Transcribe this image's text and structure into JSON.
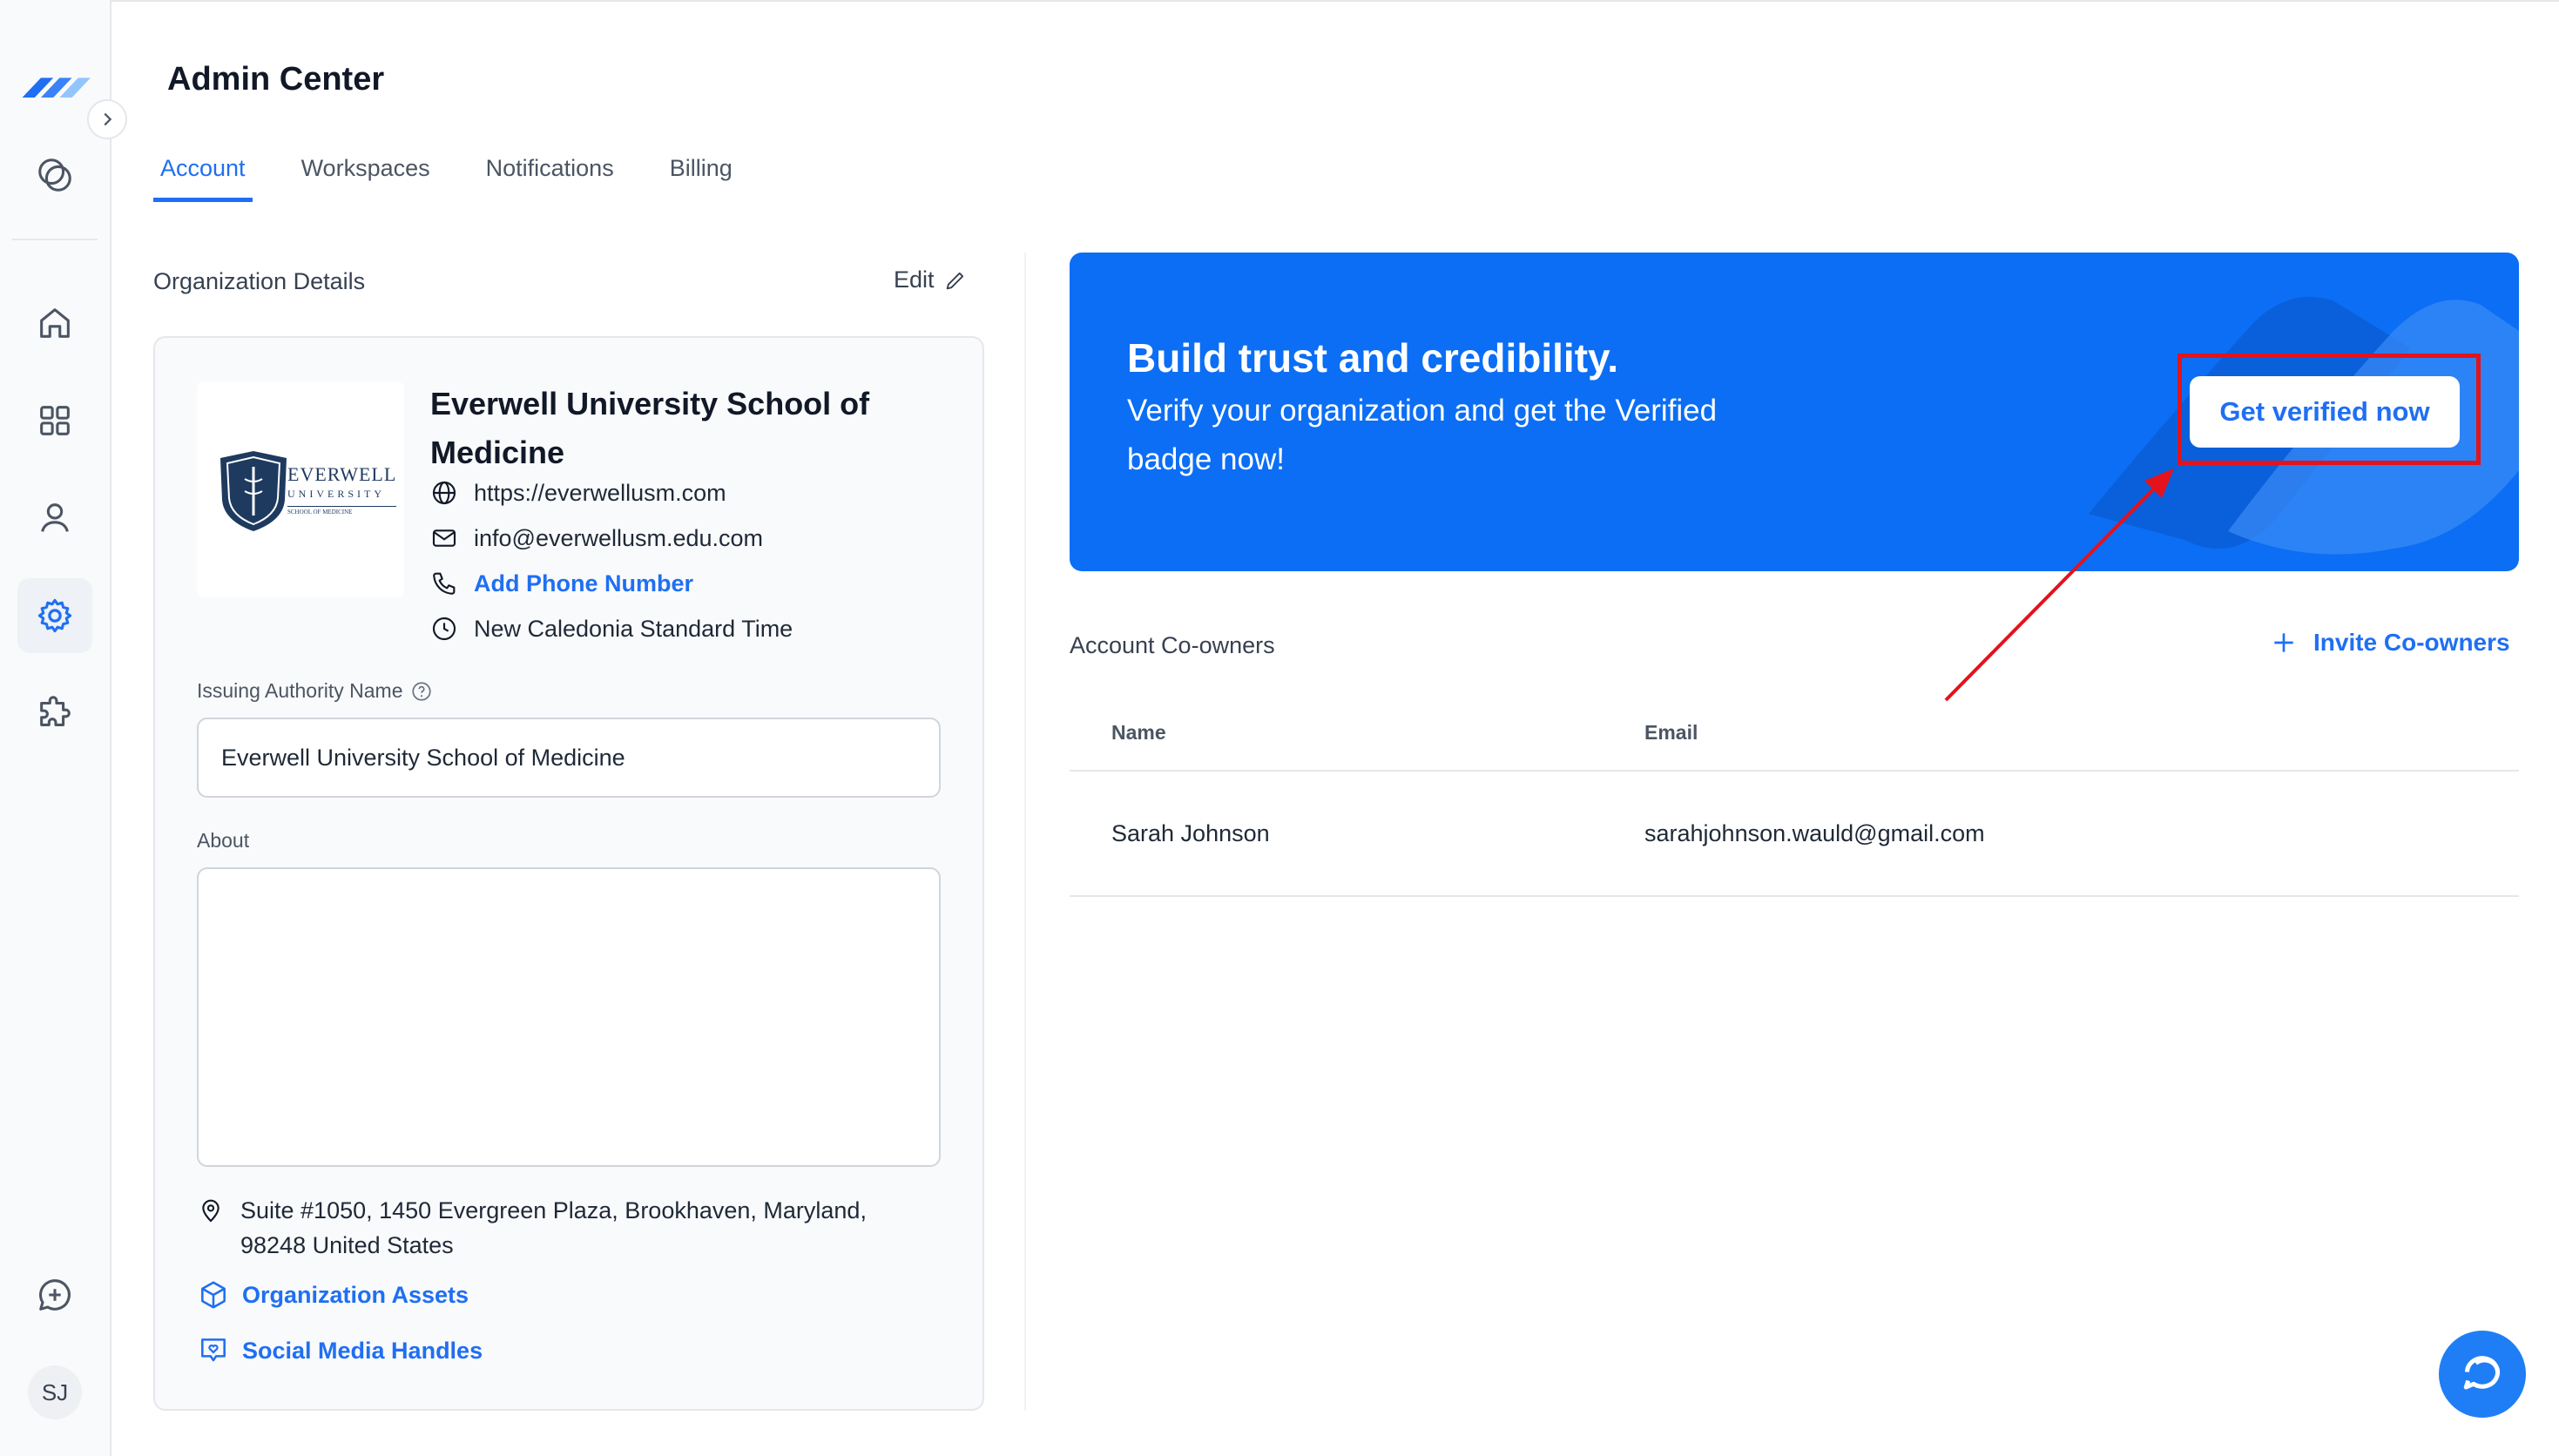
{
  "app": {
    "title": "Admin Center"
  },
  "tabs": [
    {
      "label": "Account",
      "active": true
    },
    {
      "label": "Workspaces",
      "active": false
    },
    {
      "label": "Notifications",
      "active": false
    },
    {
      "label": "Billing",
      "active": false
    }
  ],
  "sidebar": {
    "icons": [
      "logo-icon",
      "credentials-icon",
      "home-icon",
      "apps-grid-icon",
      "user-icon",
      "settings-icon",
      "puzzle-icon",
      "chat-plus-icon"
    ],
    "avatar": "SJ"
  },
  "org": {
    "section_title": "Organization Details",
    "edit_label": "Edit",
    "logo_text_main": "EVERWELL",
    "logo_text_sub": "UNIVERSITY",
    "logo_text_tag": "SCHOOL OF MEDICINE",
    "name": "Everwell University School of Medicine",
    "website": "https://everwellusm.com",
    "email": "info@everwellusm.edu.com",
    "phone_label": "Add Phone Number",
    "timezone": "New Caledonia Standard Time",
    "authority_label": "Issuing Authority Name",
    "authority_value": "Everwell University School of Medicine",
    "about_label": "About",
    "about_value": "",
    "address_line1": "Suite #1050, 1450 Evergreen Plaza, Brookhaven, Maryland,",
    "address_line2": "98248 United States",
    "assets_label": "Organization Assets",
    "social_label": "Social Media Handles"
  },
  "banner": {
    "title": "Build trust and credibility.",
    "subtitle": "Verify your organization and get the Verified badge now!",
    "button_label": "Get verified now",
    "bg_color": "#0b6ef5"
  },
  "coowners": {
    "section_title": "Account Co-owners",
    "invite_label": "Invite Co-owners",
    "columns": [
      "Name",
      "Email"
    ],
    "rows": [
      {
        "name": "Sarah Johnson",
        "email": "sarahjohnson.wauld@gmail.com"
      }
    ]
  },
  "colors": {
    "accent": "#1f6ff2",
    "annotation": "#e4121b"
  }
}
